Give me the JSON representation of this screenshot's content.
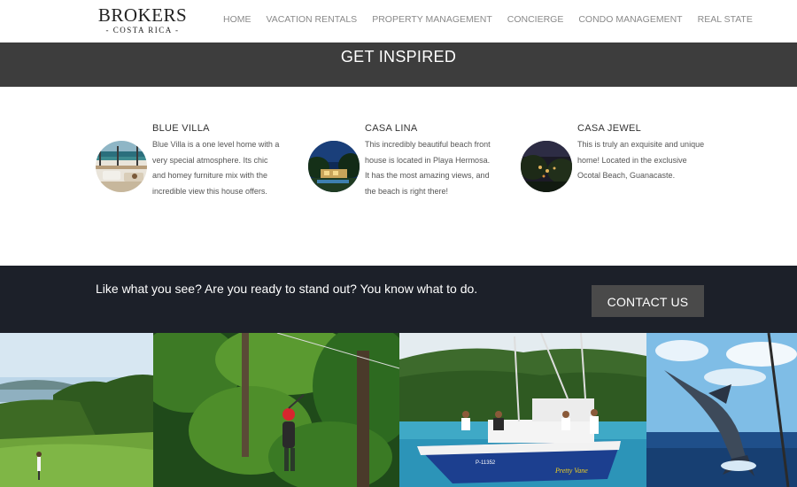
{
  "logo": {
    "main": "BROKERS",
    "sub": "- COSTA RICA -"
  },
  "nav": {
    "items": [
      {
        "label": "HOME"
      },
      {
        "label": "VACATION RENTALS"
      },
      {
        "label": "PROPERTY MANAGEMENT"
      },
      {
        "label": "CONCIERGE"
      },
      {
        "label": "CONDO MANAGEMENT"
      },
      {
        "label": "REAL STATE"
      }
    ]
  },
  "banner": {
    "title": "GET INSPIRED"
  },
  "properties": [
    {
      "title": "BLUE VILLA",
      "description": "Blue Villa is a one level home with a very special atmosphere. Its chic and homey furniture mix with the incredible view this house offers."
    },
    {
      "title": "CASA LINA",
      "description": "This incredibly beautiful beach front house is located in Playa Hermosa. It has the most amazing views, and the beach is right there!"
    },
    {
      "title": "CASA JEWEL",
      "description": "This is truly an exquisite and unique home! Located in the exclusive Ocotal Beach, Guanacaste."
    }
  ],
  "cta": {
    "text": "Like what you see? Are you ready to stand out? You know what to do.",
    "button_label": "CONTACT US"
  },
  "gallery": {
    "boat_label": "P-11352",
    "boat_name": "Pretty Vane"
  },
  "colors": {
    "banner_bg": "#3d3d3d",
    "cta_bg": "#1c2029",
    "button_bg": "#4a4a4a",
    "nav_text": "#8a8a8a"
  }
}
